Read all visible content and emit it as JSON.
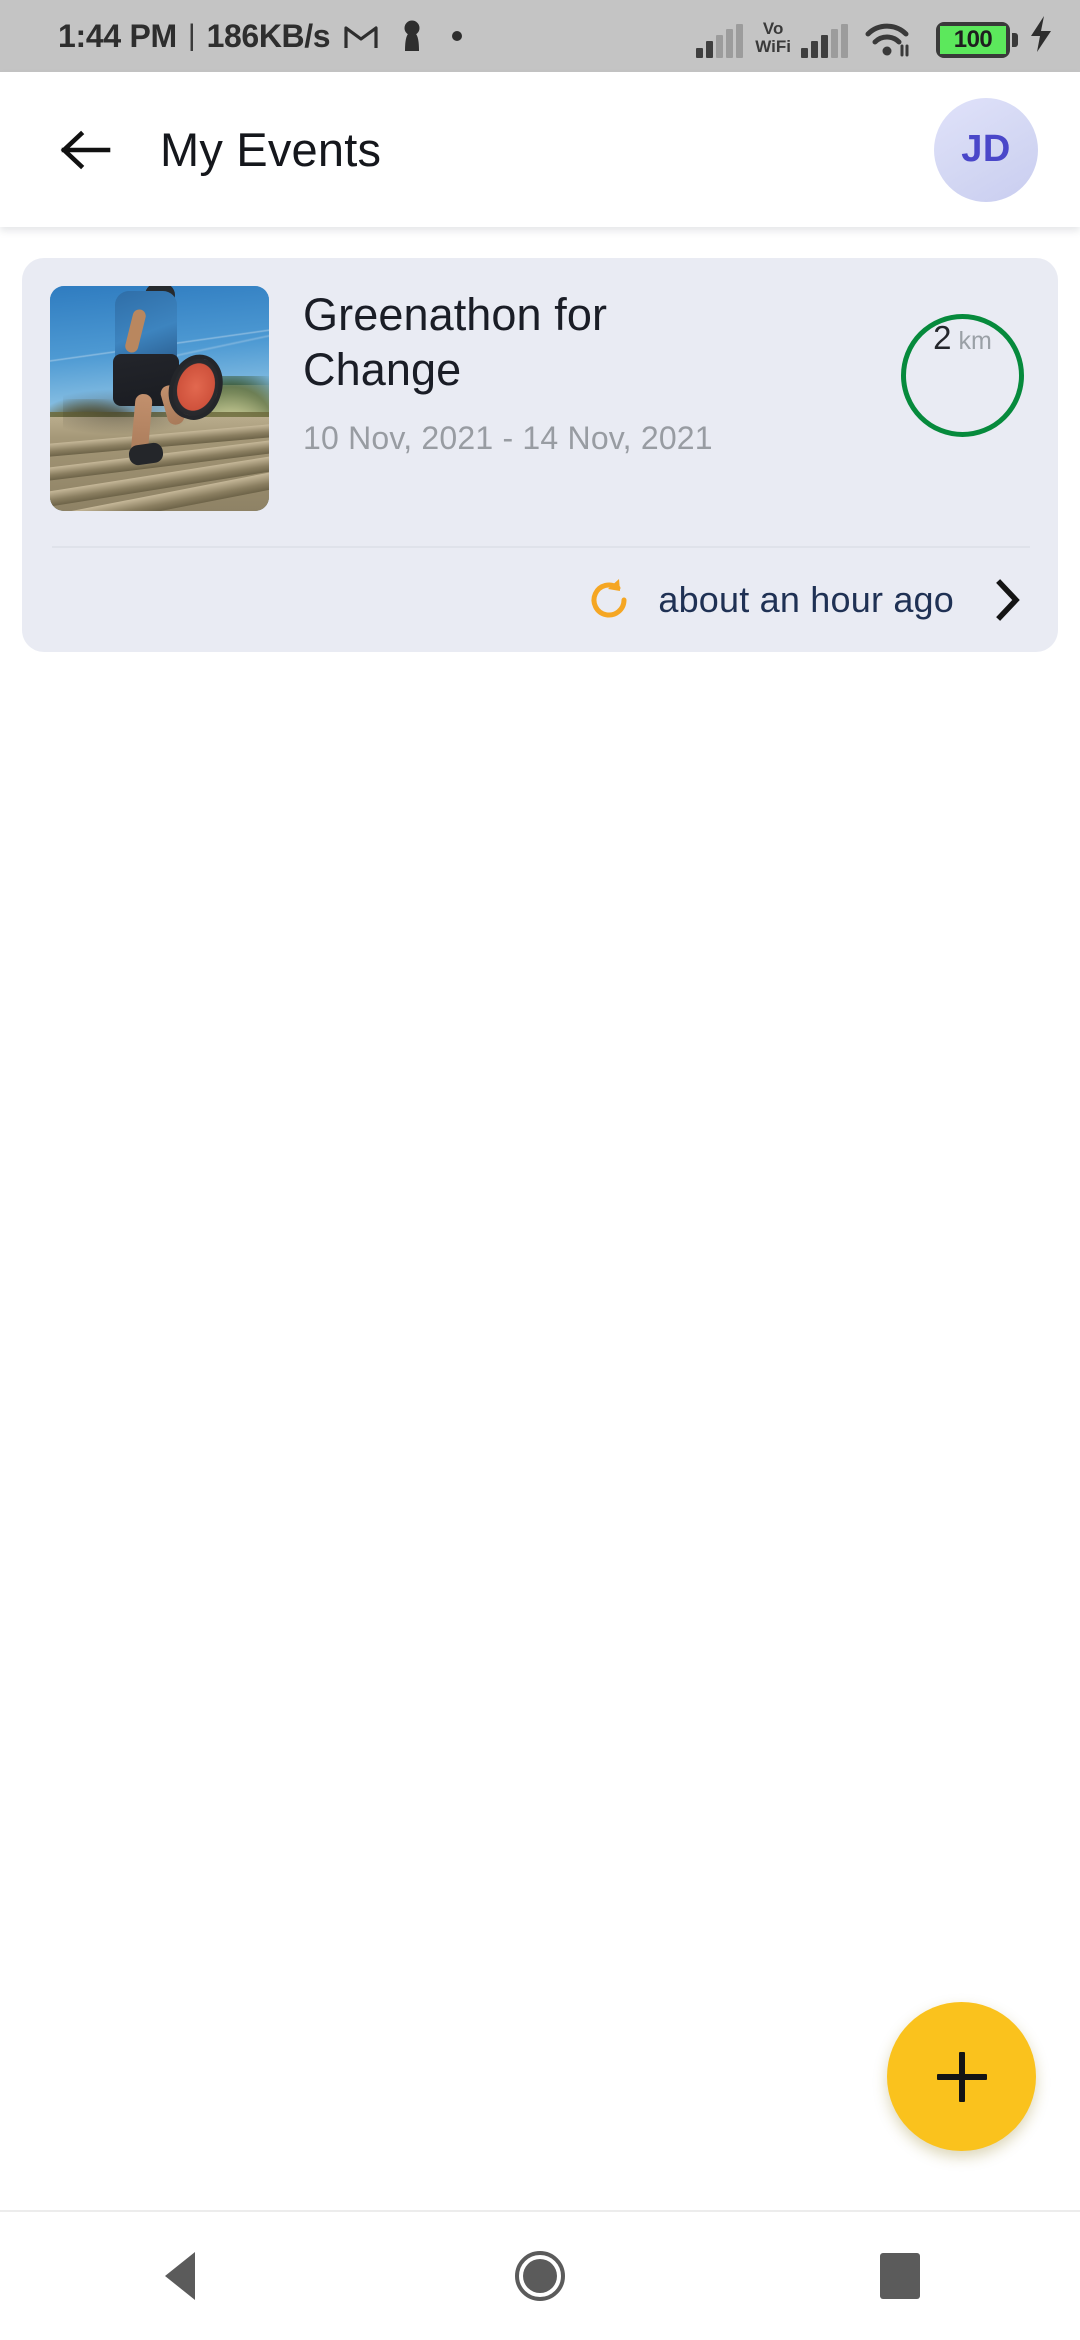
{
  "status_bar": {
    "time": "1:44 PM",
    "separator": "|",
    "network_speed": "186KB/s",
    "gmail_icon": "gmail-icon",
    "person_icon": "person-icon",
    "dot_icon": "dot-icon",
    "signal_1_icon": "signal-bars-icon",
    "volte_label_line1": "Vo",
    "volte_label_line2": "WiFi",
    "signal_2_icon": "signal-bars-icon",
    "wifi_icon": "wifi-icon",
    "battery_level": "100",
    "charging_icon": "charging-bolt-icon",
    "background_color": "#c4c4c4"
  },
  "app_bar": {
    "back_icon": "arrow-left-icon",
    "title": "My Events",
    "avatar_initials": "JD",
    "avatar_bg_color": "#d5d8f2",
    "avatar_text_color": "#4a47c9"
  },
  "events": [
    {
      "thumbnail_alt": "runner-on-boardwalk-photo",
      "title": "Greenathon for Change",
      "date_range": "10 Nov, 2021 - 14 Nov, 2021",
      "distance_value": "2",
      "distance_unit": "km",
      "distance_ring_color": "#068a3c",
      "sync_icon": "refresh-icon",
      "sync_icon_color": "#f5a623",
      "last_synced": "about an hour ago",
      "chevron_icon": "chevron-right-icon",
      "card_bg_color": "#e9ebf3"
    }
  ],
  "fab": {
    "icon": "plus-icon",
    "label": "+",
    "color": "#fac21d"
  },
  "nav_bar": {
    "back_icon": "nav-back-triangle-icon",
    "home_icon": "nav-home-circle-icon",
    "recents_icon": "nav-recents-square-icon",
    "icon_color": "#5b5b5b"
  }
}
